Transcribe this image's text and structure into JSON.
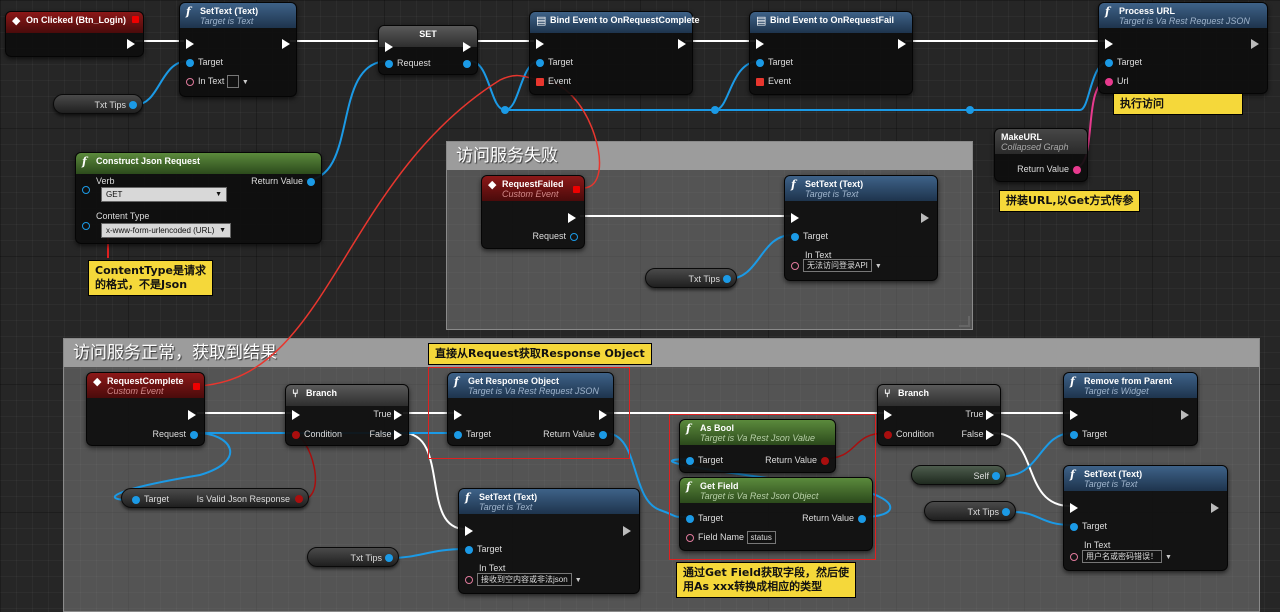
{
  "comments": {
    "fail_title": "访问服务失败",
    "success_title": "访问服务正常，获取到结果"
  },
  "nodes": {
    "on_clicked": {
      "title": "On Clicked (Btn_Login)"
    },
    "settext1": {
      "title": "SetText (Text)",
      "subtitle": "Target is Text",
      "target": "Target",
      "in_text": "In Text"
    },
    "txt_tips_1": "Txt Tips",
    "set": {
      "title": "SET",
      "request": "Request"
    },
    "bind_complete": {
      "title": "Bind Event to OnRequestComplete",
      "target": "Target",
      "event": "Event"
    },
    "bind_fail": {
      "title": "Bind Event to OnRequestFail",
      "target": "Target",
      "event": "Event"
    },
    "process_url": {
      "title": "Process URL",
      "subtitle": "Target is Va Rest Request JSON",
      "target": "Target",
      "url": "Url"
    },
    "construct_json": {
      "title": "Construct Json Request",
      "verb": "Verb",
      "verb_value": "GET",
      "content_type": "Content Type",
      "content_type_value": "x-www-form-urlencoded (URL)",
      "return_value": "Return Value"
    },
    "make_url": {
      "title": "MakeURL",
      "subtitle": "Collapsed Graph",
      "return_value": "Return Value"
    },
    "request_failed": {
      "title": "RequestFailed",
      "subtitle": "Custom Event",
      "request": "Request"
    },
    "settext_fail": {
      "title": "SetText (Text)",
      "subtitle": "Target is Text",
      "target": "Target",
      "in_text": "In Text",
      "in_text_value": "无法访问登录API"
    },
    "txt_tips_fail": "Txt Tips",
    "request_complete": {
      "title": "RequestComplete",
      "subtitle": "Custom Event",
      "request": "Request"
    },
    "branch1": {
      "title": "Branch",
      "condition": "Condition",
      "true": "True",
      "false": "False"
    },
    "is_valid": {
      "target": "Target",
      "label": "Is Valid Json Response"
    },
    "get_response": {
      "title": "Get Response Object",
      "subtitle": "Target is Va Rest Request JSON",
      "target": "Target",
      "return_value": "Return Value"
    },
    "settext_bad": {
      "title": "SetText (Text)",
      "subtitle": "Target is Text",
      "target": "Target",
      "in_text": "In Text",
      "in_text_value": "接收到空内容或非法json"
    },
    "txt_tips_bad": "Txt Tips",
    "as_bool": {
      "title": "As Bool",
      "subtitle": "Target is Va Rest Json Value",
      "target": "Target",
      "return_value": "Return Value"
    },
    "get_field": {
      "title": "Get Field",
      "subtitle": "Target is Va Rest Json Object",
      "target": "Target",
      "return_value": "Return Value",
      "field_name": "Field Name",
      "field_name_value": "status"
    },
    "branch2": {
      "title": "Branch",
      "condition": "Condition",
      "true": "True",
      "false": "False"
    },
    "self_pill": "Self",
    "txt_tips_right": "Txt Tips",
    "remove_parent": {
      "title": "Remove from Parent",
      "subtitle": "Target is Widget",
      "target": "Target"
    },
    "settext_wrong": {
      "title": "SetText (Text)",
      "subtitle": "Target is Text",
      "target": "Target",
      "in_text": "In Text",
      "in_text_value": "用户名或密码错误！"
    }
  },
  "annotations": {
    "exec_access": "执行访问",
    "make_url_note": "拼装URL,以Get方式传参",
    "content_type_note_1": "ContentType是请求",
    "content_type_note_2": "的格式，不是Json",
    "response_note": "直接从Request获取Response Object",
    "field_note_1": "通过Get Field获取字段，然后使",
    "field_note_2": "用As xxx转换成相应的类型"
  },
  "colors": {
    "exec_wire": "#ffffff",
    "object_wire": "#1b9ae6",
    "event_wire": "#e8362e",
    "string_wire": "#e83a8e",
    "bool_wire": "#a90e0e",
    "annotation_bg": "#f5d83a"
  }
}
